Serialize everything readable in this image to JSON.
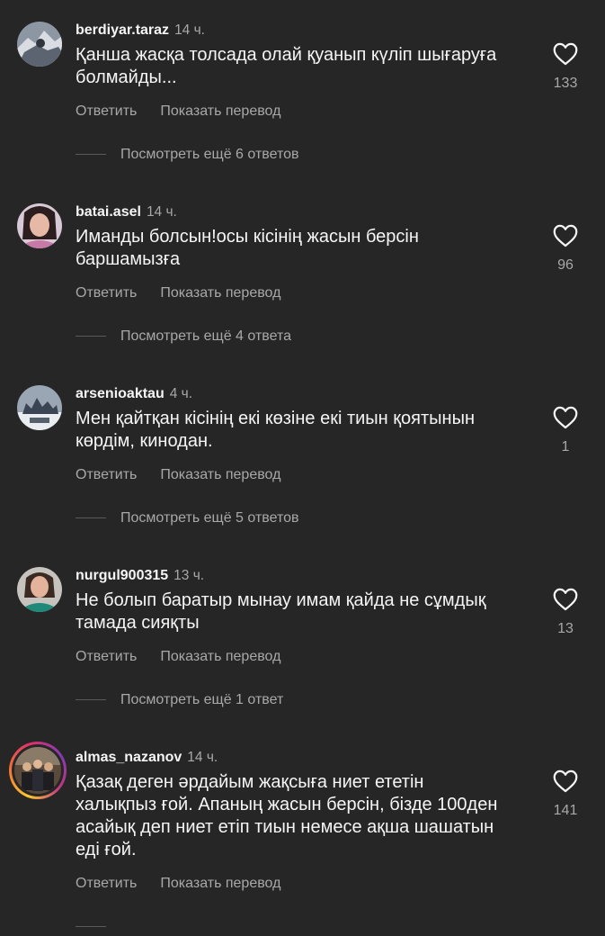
{
  "actions": {
    "reply": "Ответить",
    "translate": "Показать перевод"
  },
  "comments": [
    {
      "username": "berdiyar.taraz",
      "time": "14 ч.",
      "text": "Қанша жасқа толсада олай қуанып күліп шығаруға болмайды...",
      "likes": "133",
      "replies": "Посмотреть ещё 6 ответов"
    },
    {
      "username": "batai.asel",
      "time": "14 ч.",
      "text": "Иманды болсын!осы кісінің жасын берсін баршамызға",
      "likes": "96",
      "replies": "Посмотреть ещё 4 ответа"
    },
    {
      "username": "arsenioaktau",
      "time": "4 ч.",
      "text": "Мен қайтқан кісінің екі көзіне екі тиын қоятынын көрдім, кинодан.",
      "likes": "1",
      "replies": "Посмотреть ещё 5 ответов"
    },
    {
      "username": "nurgul900315",
      "time": "13 ч.",
      "text": "Не болып баратыр мынау имам қайда не сұмдық тамада сияқты",
      "likes": "13",
      "replies": "Посмотреть ещё 1 ответ"
    },
    {
      "username": "almas_nazanov",
      "time": "14 ч.",
      "text": "Қазақ деген әрдайым жақсыға ниет ететін халықпыз ғой. Апаның жасын берсін, бізде 100ден асайық деп ниет етіп тиын немесе ақша шашатын еді ғой.",
      "likes": "141"
    }
  ],
  "colors": {
    "background": "#262626",
    "primary_text": "#f5f5f5",
    "secondary_text": "#a8a8a8"
  },
  "icons": {
    "like": "heart-outline-icon"
  }
}
